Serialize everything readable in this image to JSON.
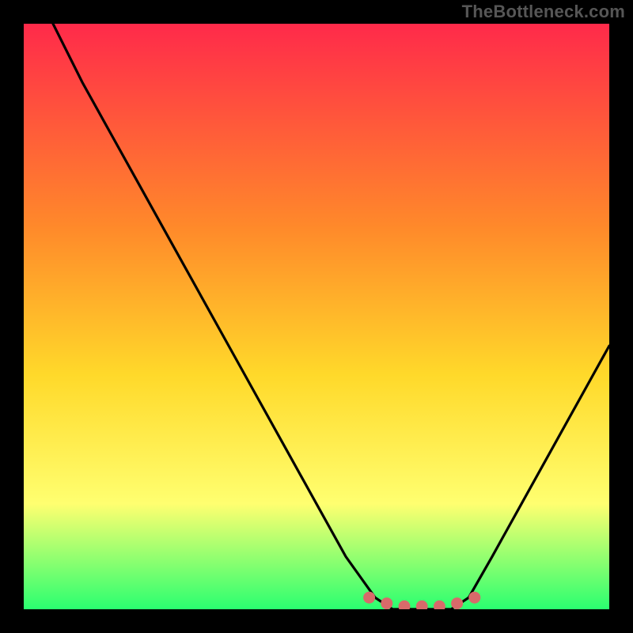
{
  "attribution": "TheBottleneck.com",
  "colors": {
    "bg": "#000000",
    "gradient_top": "#ff2a4a",
    "gradient_mid1": "#ff8a2a",
    "gradient_mid2": "#ffd92a",
    "gradient_mid3": "#ffff70",
    "gradient_bottom": "#2aff70",
    "curve": "#000000",
    "marker": "#d86a6a"
  },
  "chart_data": {
    "type": "line",
    "title": "",
    "xlabel": "",
    "ylabel": "",
    "xlim": [
      0,
      100
    ],
    "ylim": [
      0,
      100
    ],
    "grid": false,
    "series": [
      {
        "name": "bottleneck-curve",
        "x": [
          5,
          10,
          15,
          20,
          25,
          30,
          35,
          40,
          45,
          50,
          55,
          60,
          63,
          66,
          70,
          73,
          76,
          80,
          85,
          90,
          95,
          100
        ],
        "values": [
          100,
          90,
          81,
          72,
          63,
          54,
          45,
          36,
          27,
          18,
          9,
          2,
          0,
          0,
          0,
          0,
          2,
          9,
          18,
          27,
          36,
          45
        ]
      }
    ],
    "markers": [
      {
        "x": 59,
        "y": 2
      },
      {
        "x": 62,
        "y": 1
      },
      {
        "x": 65,
        "y": 0.5
      },
      {
        "x": 68,
        "y": 0.5
      },
      {
        "x": 71,
        "y": 0.5
      },
      {
        "x": 74,
        "y": 1
      },
      {
        "x": 77,
        "y": 2
      }
    ],
    "annotations": []
  }
}
